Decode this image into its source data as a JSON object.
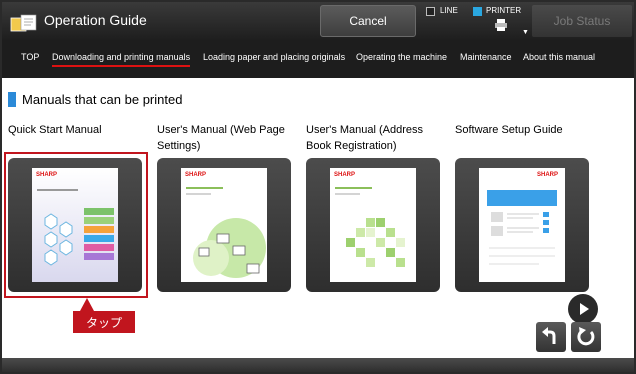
{
  "header": {
    "title": "Operation Guide",
    "cancel_label": "Cancel",
    "line_label": "LINE",
    "printer_label": "PRINTER",
    "job_status_label": "Job Status",
    "colors": {
      "printer_indicator": "#2aa7e0"
    }
  },
  "nav": {
    "items": [
      {
        "label": "TOP"
      },
      {
        "label": "Downloading and printing manuals"
      },
      {
        "label": "Loading paper and placing originals"
      },
      {
        "label": "Operating the machine"
      },
      {
        "label": "Maintenance"
      },
      {
        "label": "About this manual"
      }
    ],
    "active_index": 1,
    "active_underline_color": "#dd1111"
  },
  "main": {
    "section_title": "Manuals that can be printed",
    "manuals": [
      {
        "title_line1": "Quick Start Manual",
        "title_line2": "",
        "brand": "SHARP"
      },
      {
        "title_line1": "User's Manual (Web Page",
        "title_line2": "Settings)",
        "brand": "SHARP"
      },
      {
        "title_line1": "User's Manual (Address",
        "title_line2": "Book Registration)",
        "brand": "SHARP"
      },
      {
        "title_line1": "Software Setup Guide",
        "title_line2": "",
        "brand": "SHARP"
      }
    ],
    "annotation": "タップ",
    "controls": [
      "next-icon",
      "back-icon",
      "refresh-icon"
    ],
    "colors": {
      "accent": "#2b8ad8",
      "annotation": "#c1151e"
    }
  }
}
